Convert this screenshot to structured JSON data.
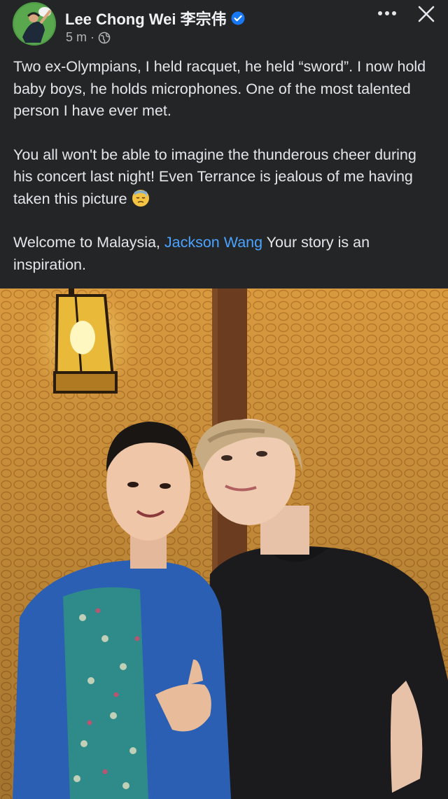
{
  "post": {
    "author_name": "Lee Chong Wei 李宗伟",
    "timestamp": "5 m",
    "separator": "·",
    "paragraph_1": "Two ex-Olympians, I held racquet, he held “sword”. I now hold baby boys, he holds microphones. One of the most talented person I have ever met.",
    "paragraph_2": "You all won't be able to imagine the thunderous cheer during his concert last night! Even Terrance is jealous of me having taken this picture",
    "paragraph_3_prefix": "Welcome to Malaysia, ",
    "mention": "Jackson Wang",
    "paragraph_3_suffix": " Your story is an inspiration."
  },
  "icons": {
    "more": "more-horizontal-icon",
    "close": "close-icon",
    "audience": "globe-icon",
    "verified": "verified-badge-icon",
    "emoji": "downcast-sweat-emoji"
  },
  "colors": {
    "background": "#242526",
    "text": "#e4e6eb",
    "link": "#4aa3ff",
    "verified": "#1877f2",
    "wall": "#d99a3f"
  }
}
